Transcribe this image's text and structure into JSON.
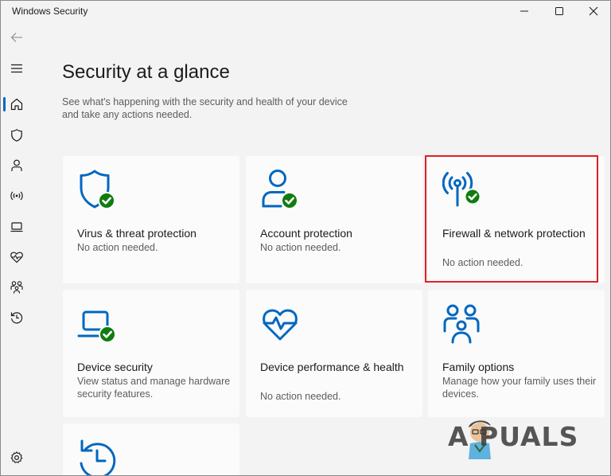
{
  "window": {
    "title": "Windows Security",
    "controls": [
      "minimize",
      "maximize",
      "close"
    ]
  },
  "sidebar": {
    "items": [
      {
        "name": "back",
        "icon": "back-arrow-icon"
      },
      {
        "name": "menu",
        "icon": "hamburger-icon"
      },
      {
        "name": "home",
        "icon": "home-icon",
        "selected": true
      },
      {
        "name": "virus-threat",
        "icon": "shield-icon"
      },
      {
        "name": "account",
        "icon": "person-icon"
      },
      {
        "name": "firewall",
        "icon": "wireless-icon"
      },
      {
        "name": "app-browser",
        "icon": "laptop-window-icon"
      },
      {
        "name": "device-security",
        "icon": "heart-pulse-icon"
      },
      {
        "name": "family",
        "icon": "family-icon"
      },
      {
        "name": "history",
        "icon": "history-icon"
      },
      {
        "name": "settings",
        "icon": "gear-icon"
      }
    ]
  },
  "main": {
    "title": "Security at a glance",
    "description": "See what's happening with the security and health of your device and take any actions needed.",
    "cards": [
      {
        "title": "Virus & threat protection",
        "status": "No action needed.",
        "icon": "shield-check-icon"
      },
      {
        "title": "Account protection",
        "status": "No action needed.",
        "icon": "person-check-icon"
      },
      {
        "title": "Firewall & network protection",
        "status": "No action needed.",
        "icon": "antenna-check-icon"
      },
      {
        "title": "Device security",
        "status": "View status and manage hardware security features.",
        "icon": "laptop-check-icon"
      },
      {
        "title": "Device performance & health",
        "status": "No action needed.",
        "icon": "heart-pulse-icon"
      },
      {
        "title": "Family options",
        "status": "Manage how your family uses their devices.",
        "icon": "family-icon"
      },
      {
        "title": "",
        "status": "",
        "icon": "history-clock-icon"
      }
    ]
  },
  "watermark": {
    "text": "A  PUALS"
  },
  "colors": {
    "accent": "#0067c0",
    "ok_green": "#107c10",
    "highlight": "#e02020",
    "background": "#f3f3f3",
    "card": "#fbfbfb"
  }
}
